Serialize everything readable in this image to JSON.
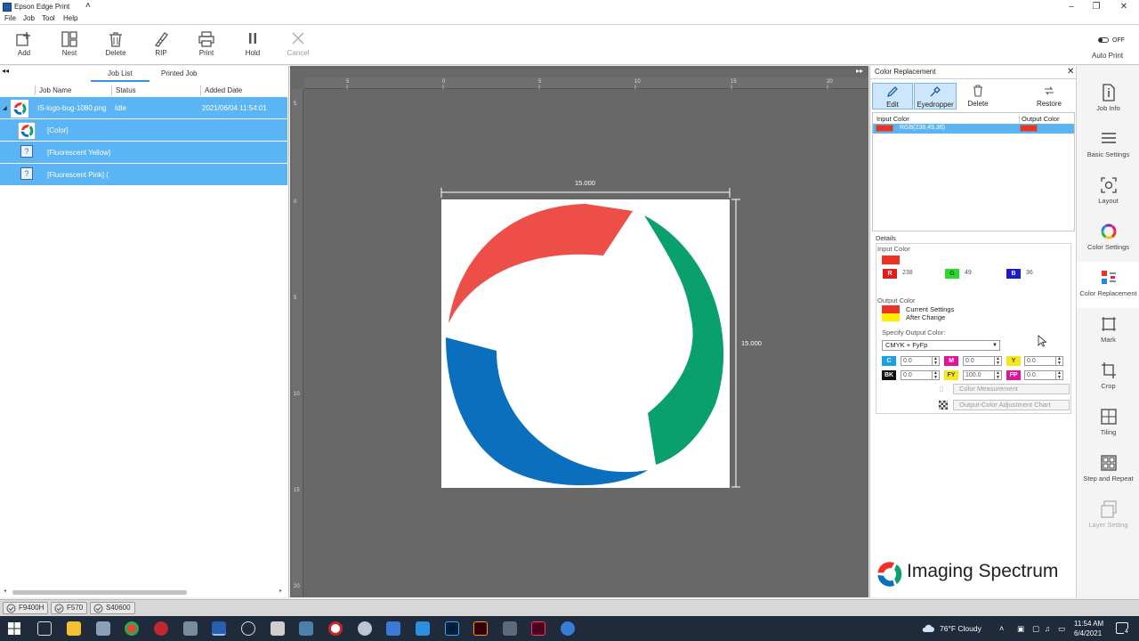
{
  "window": {
    "title": "Epson Edge Print"
  },
  "menu": [
    "File",
    "Job",
    "Tool",
    "Help"
  ],
  "toolbar": {
    "add": "Add",
    "nest": "Nest",
    "delete": "Delete",
    "rip": "RIP",
    "print": "Print",
    "hold": "Hold",
    "cancel": "Cancel",
    "auto_print_label": "Auto Print",
    "auto_print_state": "OFF"
  },
  "left": {
    "tabs": {
      "job_list": "Job List",
      "printed_job": "Printed Job"
    },
    "columns": {
      "job_name": "Job Name",
      "status": "Status",
      "added_date": "Added Date"
    },
    "job": {
      "name": "IS-logo-bug-1080.png",
      "status": "Idle",
      "added": "2021/06/04 11:54:01"
    },
    "children": [
      "[Color]",
      "[Fluorescent Yellow]",
      "[Fluorescent Pink]  ("
    ]
  },
  "canvas": {
    "ruler_x": [
      "5",
      "0",
      "5",
      "10",
      "15",
      "20"
    ],
    "ruler_y": [
      "5",
      "0",
      "5",
      "10",
      "15",
      "20"
    ],
    "width_dim": "15.000",
    "height_dim": "15.000"
  },
  "color_replacement": {
    "title": "Color Replacement",
    "buttons": {
      "edit": "Edit",
      "eyedropper": "Eyedropper",
      "delete": "Delete",
      "restore": "Restore"
    },
    "list_headers": {
      "input": "Input Color",
      "output": "Output Color"
    },
    "list_row": {
      "value": "RGB(238,49,36)"
    },
    "details": {
      "title": "Details",
      "input_color_label": "Input Color",
      "r_label": "R",
      "r": "238",
      "g_label": "G",
      "g": "49",
      "b_label": "B",
      "b": "36",
      "output_color_label": "Output Color",
      "current_settings": "Current Settings",
      "after_change": "After Change",
      "specify_label": "Specify Output Color:",
      "mode": "CMYK + FyFp",
      "c_label": "C",
      "c": "0.0",
      "m_label": "M",
      "m": "0.0",
      "y_label": "Y",
      "y": "0.0",
      "bk_label": "BK",
      "bk": "0.0",
      "fy_label": "FY",
      "fy": "100.0",
      "fp_label": "FP",
      "fp": "0.0",
      "color_measurement": "Color Measurement",
      "adjust_chart": "Output-Color Adjustment Chart"
    },
    "colors": {
      "input": "#ee3124",
      "after": "#ffee00"
    }
  },
  "brand": {
    "name": "Imaging Spectrum"
  },
  "sidebar": [
    "Job Info",
    "Basic Settings",
    "Layout",
    "Color Settings",
    "Color Replacement",
    "Mark",
    "Crop",
    "Tiling",
    "Step and Repeat",
    "Layer Setting"
  ],
  "printers": [
    "F9400H",
    "F570",
    "S40600"
  ],
  "taskbar": {
    "weather": "76°F  Cloudy",
    "time": "11:54 AM",
    "date": "6/4/2021",
    "notifications": "4"
  }
}
